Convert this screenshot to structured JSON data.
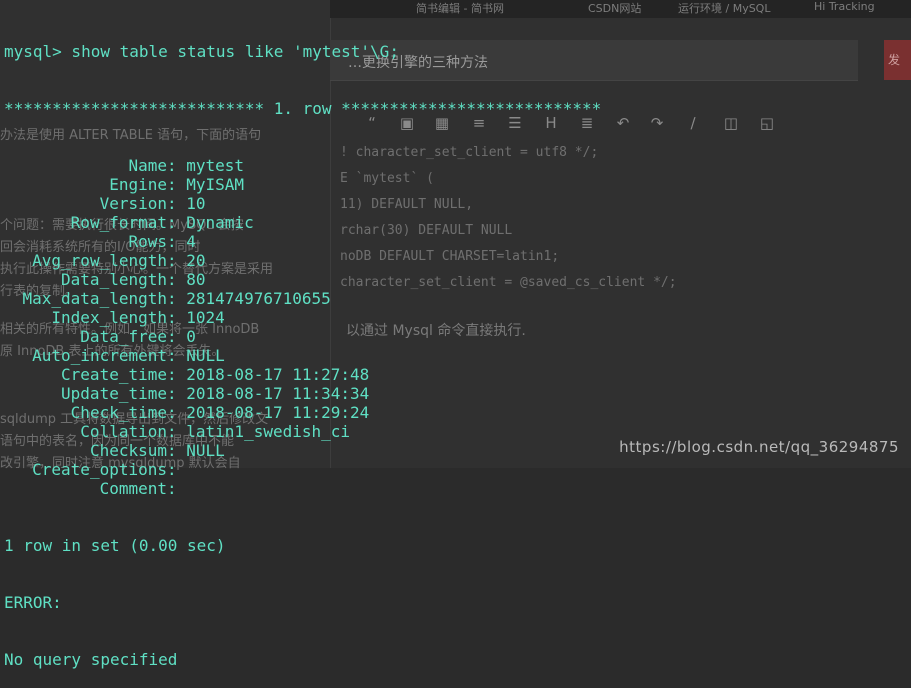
{
  "background": {
    "tabs": [
      "简书编辑 - 简书网",
      "CSDN网站",
      "运行环境 / MySQL",
      "Hi Tracking"
    ],
    "title": "…更换引擎的三种方法",
    "publish_label": "发",
    "toolbar_icons": [
      "quote-icon",
      "image-box-icon",
      "image-icon",
      "ordered-list-icon",
      "unordered-list-icon",
      "heading-icon",
      "hr-icon",
      "undo-icon",
      "redo-icon",
      "pen-icon",
      "trash-icon",
      "fullscreen-icon"
    ],
    "code_lines": [
      "! character_set_client = utf8 */;",
      "E `mytest` (",
      "11) DEFAULT NULL,",
      "rchar(30) DEFAULT NULL",
      "noDB DEFAULT CHARSET=latin1;",
      "character_set_client = @saved_cs_client */;"
    ],
    "note": "以通过 Mysql 命令直接执行.",
    "left_fragments": [
      "办法是使用 ALTER TABLE 语句，下面的语句",
      "个问题：需要执行很长时间。MySQL 会按",
      "回会消耗系统所有的I/O能力，同时",
      "执行此操作需要特别小心。一个替代方案是采用",
      "行表的复制。",
      "相关的所有特性。例如，如果将一张 InnoDB",
      "原 InnoDB 表上的所有外键将会丢失。",
      "sqldump 工具将数据导出到文件，然后修改文",
      "语句中的表名，因为同一个数据库中不能",
      "改引擎，同时注意 mysqldump 默认会自"
    ],
    "watermark": "https://blog.csdn.net/qq_36294875"
  },
  "terminal": {
    "command": "mysql> show table status like 'mytest'\\G;",
    "row_header": "*************************** 1. row ***************************",
    "fields": [
      {
        "label": "Name",
        "value": "mytest"
      },
      {
        "label": "Engine",
        "value": "MyISAM"
      },
      {
        "label": "Version",
        "value": "10"
      },
      {
        "label": "Row_format",
        "value": "Dynamic"
      },
      {
        "label": "Rows",
        "value": "4"
      },
      {
        "label": "Avg_row_length",
        "value": "20"
      },
      {
        "label": "Data_length",
        "value": "80"
      },
      {
        "label": "Max_data_length",
        "value": "281474976710655"
      },
      {
        "label": "Index_length",
        "value": "1024"
      },
      {
        "label": "Data_free",
        "value": "0"
      },
      {
        "label": "Auto_increment",
        "value": "NULL"
      },
      {
        "label": "Create_time",
        "value": "2018-08-17 11:27:48"
      },
      {
        "label": "Update_time",
        "value": "2018-08-17 11:34:34"
      },
      {
        "label": "Check_time",
        "value": "2018-08-17 11:29:24"
      },
      {
        "label": "Collation",
        "value": "latin1_swedish_ci"
      },
      {
        "label": "Checksum",
        "value": "NULL"
      },
      {
        "label": "Create_options",
        "value": ""
      },
      {
        "label": "Comment",
        "value": ""
      }
    ],
    "summary": "1 row in set (0.00 sec)",
    "error_label": "ERROR:",
    "error_message": "No query specified"
  },
  "colors": {
    "terminal_text": "#5fe0c4",
    "background": "#303030"
  }
}
